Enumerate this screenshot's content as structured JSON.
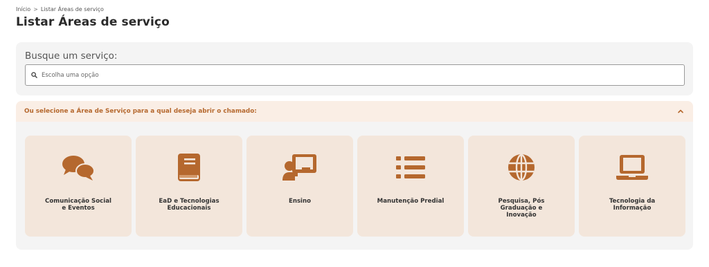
{
  "breadcrumb": {
    "home": "Início",
    "separator": ">",
    "current": "Listar Áreas de serviço"
  },
  "page": {
    "title": "Listar Áreas de serviço"
  },
  "search": {
    "label": "Busque um serviço:",
    "placeholder": "Escolha uma opção",
    "value": ""
  },
  "areas": {
    "header": "Ou selecione a Área de Serviço para a qual deseja abrir o chamado:",
    "expanded": true,
    "cards": [
      {
        "label": "Comunicação Social\ne Eventos",
        "icon": "comments-icon"
      },
      {
        "label": "EaD e Tecnologias\nEducacionais",
        "icon": "book-icon"
      },
      {
        "label": "Ensino",
        "icon": "teacher-board-icon"
      },
      {
        "label": "Manutenção Predial",
        "icon": "list-icon"
      },
      {
        "label": "Pesquisa, Pós\nGraduação e\nInovação",
        "icon": "globe-icon"
      },
      {
        "label": "Tecnologia da\nInformação",
        "icon": "laptop-icon"
      }
    ]
  },
  "colors": {
    "accent": "#b5682e",
    "card_bg": "#f3e6db",
    "header_bg": "#faeee5",
    "panel_bg": "#f4f4f4"
  }
}
